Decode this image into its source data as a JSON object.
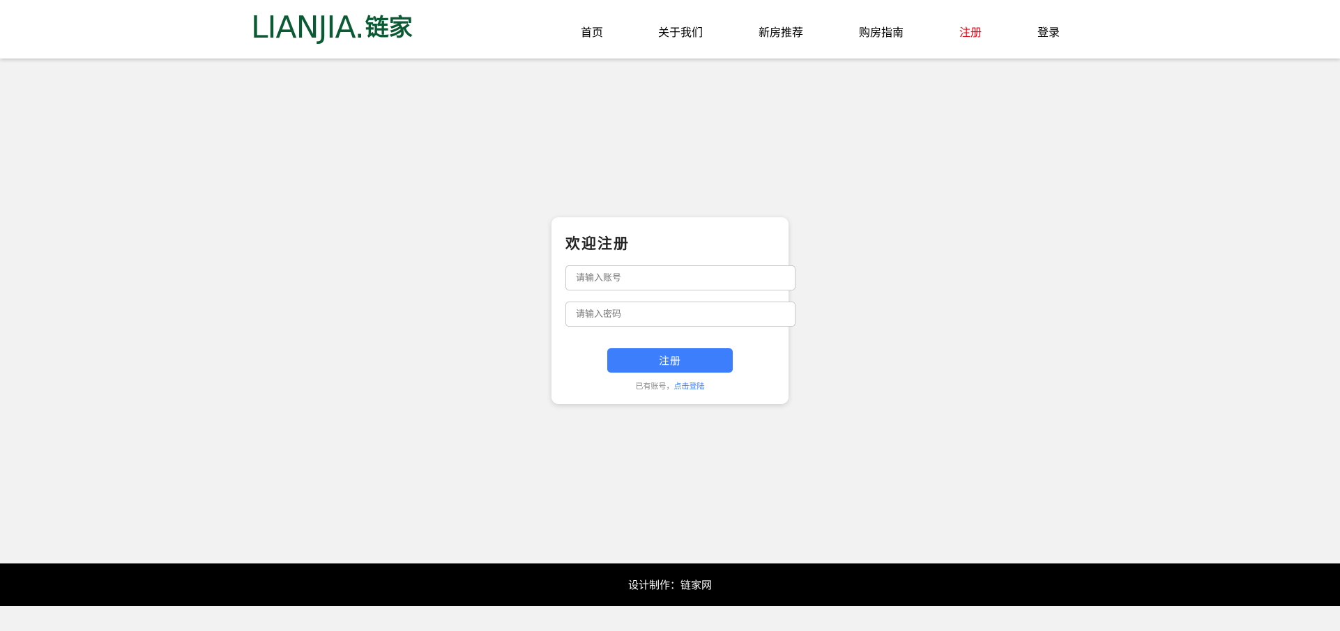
{
  "brand": {
    "logo_latin": "LIANJIA.",
    "logo_cn": "链家",
    "color": "#0a5a34"
  },
  "nav": {
    "items": [
      {
        "label": "首页"
      },
      {
        "label": "关于我们"
      },
      {
        "label": "新房推荐"
      },
      {
        "label": "购房指南"
      },
      {
        "label": "注册",
        "active": true
      },
      {
        "label": "登录"
      }
    ],
    "active_color": "#e60012"
  },
  "register": {
    "title": "欢迎注册",
    "account_placeholder": "请输入账号",
    "password_placeholder": "请输入密码",
    "submit_label": "注册",
    "hint_text": "已有账号，",
    "hint_link": "点击登陆",
    "accent_color": "#3d7efc"
  },
  "footer": {
    "text": "设计制作：链家网"
  }
}
